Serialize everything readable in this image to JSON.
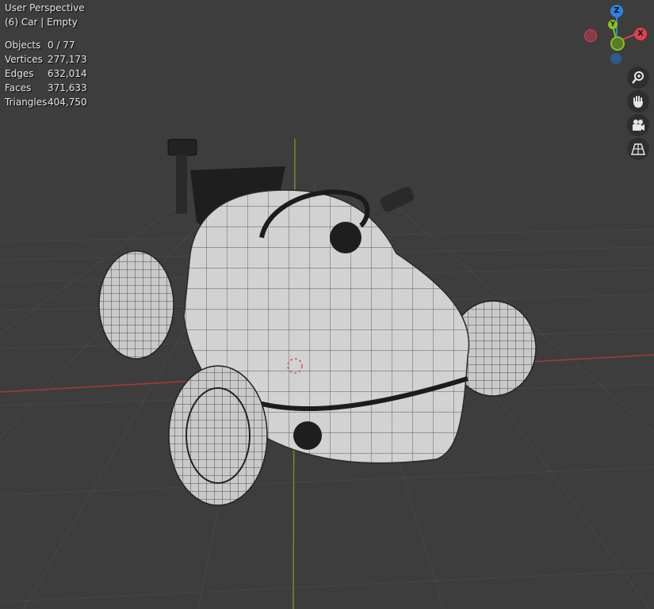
{
  "viewport": {
    "view_name": "User Perspective",
    "active_object": "(6) Car | Empty"
  },
  "stats": [
    {
      "label": "Objects",
      "value": "0 / 77"
    },
    {
      "label": "Vertices",
      "value": "277,173"
    },
    {
      "label": "Edges",
      "value": "632,014"
    },
    {
      "label": "Faces",
      "value": "371,633"
    },
    {
      "label": "Triangles",
      "value": "404,750"
    }
  ],
  "gizmo": {
    "z_label": "Z",
    "x_label": "X",
    "y_label": "Y",
    "colors": {
      "x": "#e0404f",
      "y": "#84c21d",
      "z": "#2f83e2"
    }
  },
  "nav_buttons": [
    {
      "name": "zoom-icon"
    },
    {
      "name": "pan-hand-icon"
    },
    {
      "name": "camera-icon"
    },
    {
      "name": "perspective-grid-icon"
    }
  ],
  "colors": {
    "background": "#3d3d3d",
    "grid_line": "#4a4a4a",
    "x_axis": "#a03a3a",
    "y_axis": "#6a8f2a"
  }
}
